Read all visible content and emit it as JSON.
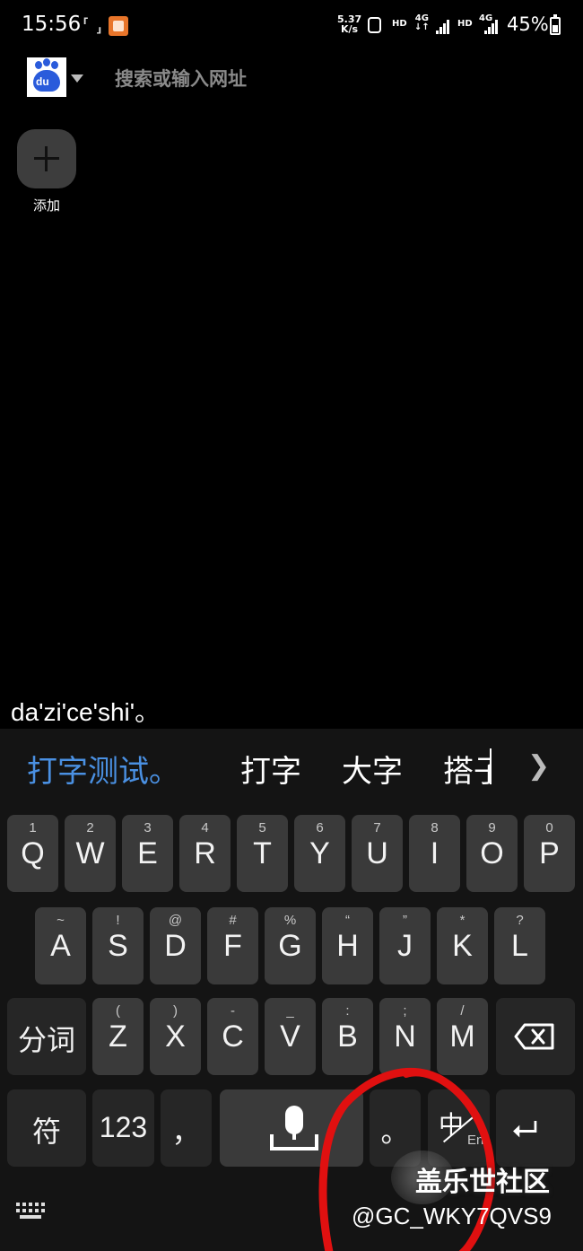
{
  "status_bar": {
    "time": "15:56",
    "net_speed_value": "5.37",
    "net_speed_unit": "K/s",
    "hd1": "HD",
    "net1": "4G",
    "hd2": "HD",
    "net2": "4G",
    "battery": "45%",
    "icons": [
      "screenshot-bracket-icon",
      "app-notification-icon",
      "lock-icon",
      "signal-icon",
      "signal-icon",
      "battery-icon"
    ]
  },
  "browser": {
    "search_placeholder": "搜索或输入网址",
    "add_label": "添加",
    "logo": "baidu-paw-logo",
    "logo_text": "du"
  },
  "composing_text": "da'zi'ce'shi'。",
  "keyboard": {
    "candidates": [
      "打字测试。",
      "打字",
      "大字",
      "搭子"
    ],
    "row1": [
      {
        "hint": "1",
        "key": "Q"
      },
      {
        "hint": "2",
        "key": "W"
      },
      {
        "hint": "3",
        "key": "E"
      },
      {
        "hint": "4",
        "key": "R"
      },
      {
        "hint": "5",
        "key": "T"
      },
      {
        "hint": "6",
        "key": "Y"
      },
      {
        "hint": "7",
        "key": "U"
      },
      {
        "hint": "8",
        "key": "I"
      },
      {
        "hint": "9",
        "key": "O"
      },
      {
        "hint": "0",
        "key": "P"
      }
    ],
    "row2": [
      {
        "hint": "~",
        "key": "A"
      },
      {
        "hint": "!",
        "key": "S"
      },
      {
        "hint": "@",
        "key": "D"
      },
      {
        "hint": "#",
        "key": "F"
      },
      {
        "hint": "%",
        "key": "G"
      },
      {
        "hint": "“",
        "key": "H"
      },
      {
        "hint": "”",
        "key": "J"
      },
      {
        "hint": "*",
        "key": "K"
      },
      {
        "hint": "?",
        "key": "L"
      }
    ],
    "row3_left": "分词",
    "row3": [
      {
        "hint": "(",
        "key": "Z"
      },
      {
        "hint": ")",
        "key": "X"
      },
      {
        "hint": "-",
        "key": "C"
      },
      {
        "hint": "_",
        "key": "V"
      },
      {
        "hint": ":",
        "key": "B"
      },
      {
        "hint": ";",
        "key": "N"
      },
      {
        "hint": "/",
        "key": "M"
      }
    ],
    "symbols_label": "符",
    "numbers_label": "123",
    "comma_label": "，",
    "period_label": "。",
    "lang_zh": "中",
    "lang_en": "En"
  },
  "watermark": {
    "site": "盖乐世社区",
    "user": "@GC_WKY7QVS9"
  },
  "colors": {
    "background": "#000000",
    "keyboard_bg": "#141414",
    "key_bg": "#3a3a3a",
    "key_dark_bg": "#262626",
    "candidate_highlight": "#4a90e2",
    "annotation_red": "#e01010"
  }
}
